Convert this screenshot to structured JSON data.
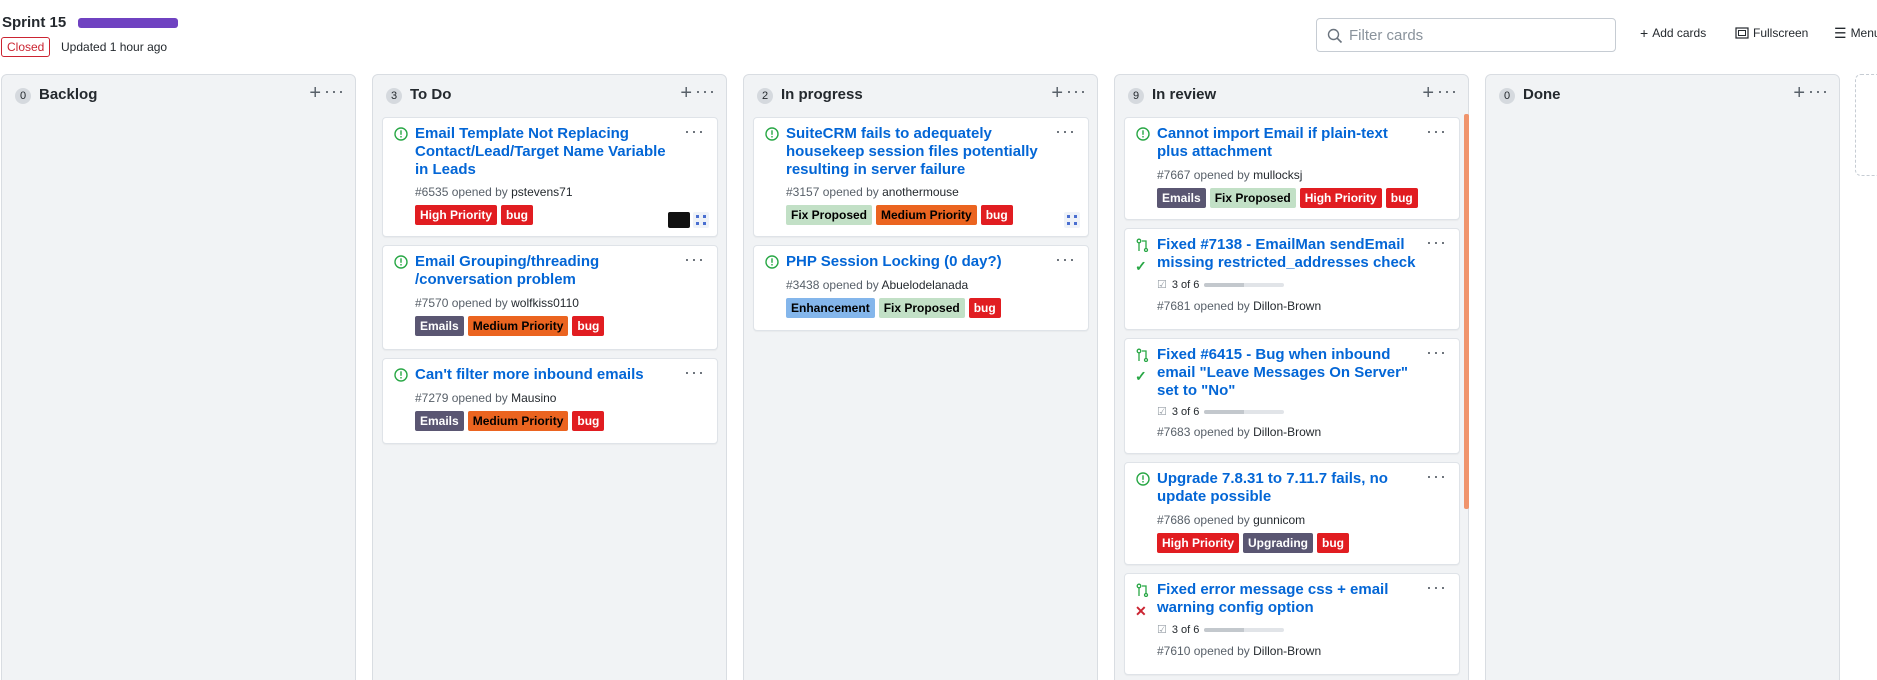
{
  "header": {
    "title": "Sprint 15",
    "status_badge": "Closed",
    "updated": "Updated 1 hour ago",
    "filter_placeholder": "Filter cards",
    "add_cards": "Add cards",
    "fullscreen": "Fullscreen",
    "menu": "Menu"
  },
  "colors": {
    "progress": "#6f42c1",
    "link": "#0366d6",
    "open_issue": "#28a745",
    "closed_badge": "#cb2431"
  },
  "columns": [
    {
      "count": "0",
      "title": "Backlog",
      "cards": []
    },
    {
      "count": "3",
      "title": "To Do",
      "cards": [
        {
          "type": "issue",
          "title": "Email Template Not Replacing Contact/Lead/Target Name Variable in Leads",
          "number": "#6535",
          "opened_by": "opened by",
          "author": "pstevens71",
          "labels": [
            {
              "text": "High Priority",
              "bg": "#e11d21",
              "fg": "#ffffff"
            },
            {
              "text": "bug",
              "bg": "#e11d21",
              "fg": "#ffffff"
            }
          ]
        },
        {
          "type": "issue",
          "title": "Email Grouping/threading /conversation problem",
          "number": "#7570",
          "opened_by": "opened by",
          "author": "wolfkiss0110",
          "labels": [
            {
              "text": "Emails",
              "bg": "#5a5672",
              "fg": "#ffffff"
            },
            {
              "text": "Medium Priority",
              "bg": "#eb6420",
              "fg": "#000000"
            },
            {
              "text": "bug",
              "bg": "#e11d21",
              "fg": "#ffffff"
            }
          ]
        },
        {
          "type": "issue",
          "title": "Can't filter more inbound emails",
          "number": "#7279",
          "opened_by": "opened by",
          "author": "Mausino",
          "labels": [
            {
              "text": "Emails",
              "bg": "#5a5672",
              "fg": "#ffffff"
            },
            {
              "text": "Medium Priority",
              "bg": "#eb6420",
              "fg": "#000000"
            },
            {
              "text": "bug",
              "bg": "#e11d21",
              "fg": "#ffffff"
            }
          ]
        }
      ]
    },
    {
      "count": "2",
      "title": "In progress",
      "cards": [
        {
          "type": "issue",
          "title": "SuiteCRM fails to adequately housekeep session files potentially resulting in server failure",
          "number": "#3157",
          "opened_by": "opened by",
          "author": "anothermouse",
          "labels": [
            {
              "text": "Fix Proposed",
              "bg": "#c2e0c6",
              "fg": "#000000"
            },
            {
              "text": "Medium Priority",
              "bg": "#eb6420",
              "fg": "#000000"
            },
            {
              "text": "bug",
              "bg": "#e11d21",
              "fg": "#ffffff"
            }
          ]
        },
        {
          "type": "issue",
          "title": "PHP Session Locking (0 day?)",
          "number": "#3438",
          "opened_by": "opened by",
          "author": "Abuelodelanada",
          "labels": [
            {
              "text": "Enhancement",
              "bg": "#84b6eb",
              "fg": "#000000"
            },
            {
              "text": "Fix Proposed",
              "bg": "#c2e0c6",
              "fg": "#000000"
            },
            {
              "text": "bug",
              "bg": "#e11d21",
              "fg": "#ffffff"
            }
          ]
        }
      ]
    },
    {
      "count": "9",
      "title": "In review",
      "cards": [
        {
          "type": "issue",
          "title": "Cannot import Email if plain-text plus attachment",
          "number": "#7667",
          "opened_by": "opened by",
          "author": "mullocksj",
          "labels": [
            {
              "text": "Emails",
              "bg": "#5a5672",
              "fg": "#ffffff"
            },
            {
              "text": "Fix Proposed",
              "bg": "#c2e0c6",
              "fg": "#000000"
            },
            {
              "text": "High Priority",
              "bg": "#e11d21",
              "fg": "#ffffff"
            },
            {
              "text": "bug",
              "bg": "#e11d21",
              "fg": "#ffffff"
            }
          ]
        },
        {
          "type": "pr",
          "check": "pass",
          "title": "Fixed #7138 - EmailMan sendEmail missing restricted_addresses check",
          "tasks": "3 of 6",
          "tasks_done": 0.5,
          "number": "#7681",
          "opened_by": "opened by",
          "author": "Dillon-Brown",
          "labels": []
        },
        {
          "type": "pr",
          "check": "pass",
          "title": "Fixed #6415 - Bug when inbound email \"Leave Messages On Server\" set to \"No\"",
          "tasks": "3 of 6",
          "tasks_done": 0.5,
          "number": "#7683",
          "opened_by": "opened by",
          "author": "Dillon-Brown",
          "labels": []
        },
        {
          "type": "issue",
          "title": "Upgrade 7.8.31 to 7.11.7 fails, no update possible",
          "number": "#7686",
          "opened_by": "opened by",
          "author": "gunnicom",
          "labels": [
            {
              "text": "High Priority",
              "bg": "#e11d21",
              "fg": "#ffffff"
            },
            {
              "text": "Upgrading",
              "bg": "#5a5672",
              "fg": "#ffffff"
            },
            {
              "text": "bug",
              "bg": "#e11d21",
              "fg": "#ffffff"
            }
          ]
        },
        {
          "type": "pr",
          "check": "fail",
          "title": "Fixed error message css + email warning config option",
          "tasks": "3 of 6",
          "tasks_done": 0.5,
          "number": "#7610",
          "opened_by": "opened by",
          "author": "Dillon-Brown",
          "labels": []
        }
      ]
    },
    {
      "count": "0",
      "title": "Done",
      "cards": []
    }
  ],
  "icons": {
    "open_issue": "issue-opened-icon",
    "pull_request": "git-pull-request-icon",
    "check_pass": "check-icon",
    "check_fail": "x-icon"
  }
}
